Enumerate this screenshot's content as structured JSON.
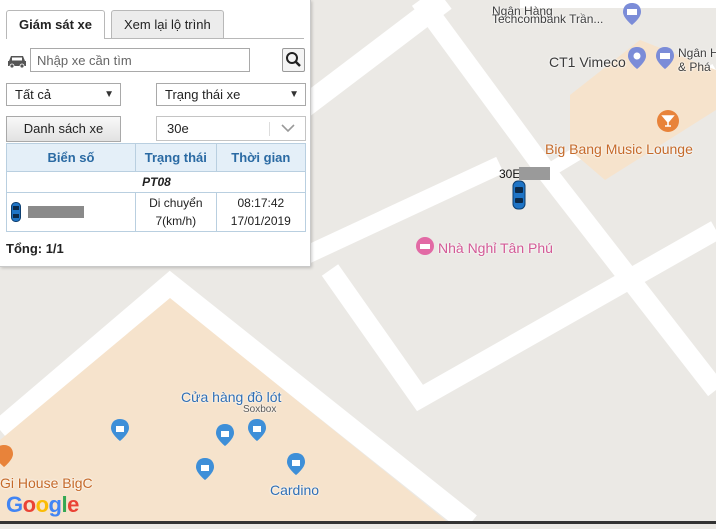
{
  "tabs": [
    {
      "label": "Giám sát xe",
      "active": true
    },
    {
      "label": "Xem lại lộ trình",
      "active": false
    }
  ],
  "search": {
    "placeholder": "Nhập xe cần tìm",
    "value": ""
  },
  "filters": {
    "group_select": "Tất cả",
    "status_select": "Trạng thái xe",
    "list_button": "Danh sách xe",
    "vehicle_combo": "30e"
  },
  "table": {
    "headers": [
      "Biển số",
      "Trạng thái",
      "Thời gian"
    ],
    "group": "PT08",
    "rows": [
      {
        "plate": "",
        "status_line1": "Di chuyển",
        "status_line2": "7(km/h)",
        "time": "08:17:42",
        "date": "17/01/2019"
      }
    ]
  },
  "total": "Tổng: 1/1",
  "map": {
    "pois": {
      "techcombank_line1": "Ngân Hàng",
      "techcombank_line2": "Techcombank Trần...",
      "vimeco": "CT1 Vimeco",
      "ngan_line1": "Ngân H",
      "ngan_line2": "& Phá",
      "bigbang": "Big Bang Music Lounge",
      "nha_nghi": "Nhà Nghỉ Tân Phú",
      "cua_hang": "Cửa hàng đồ lót",
      "soxbox": "Soxbox",
      "gi_house": "Gi House BigC",
      "cardino": "Cardino"
    },
    "vehicle_label": "30E",
    "google_logo": "Google",
    "colors": {
      "road": "#ffffff",
      "block": "#ebe9e5",
      "building": "#f6e3cc",
      "poi_blue": "#3e8fd8",
      "poi_pink": "#e26aa5",
      "poi_orange": "#e8833a"
    }
  }
}
